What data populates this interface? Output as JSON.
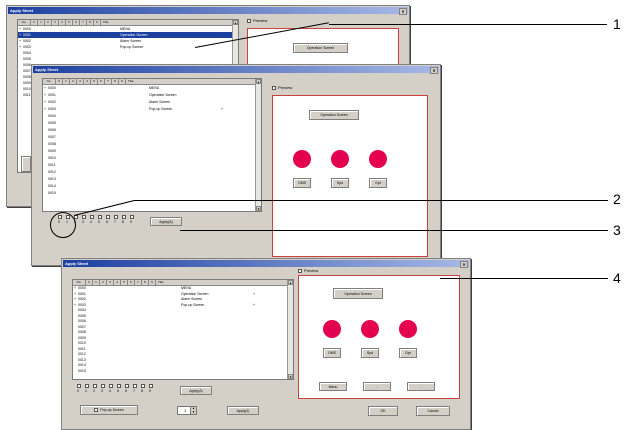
{
  "windows": [
    {
      "title": "Apply Sheet",
      "close_glyph": "✕",
      "grid_header": {
        "no": "No.",
        "cols": [
          "0",
          "1",
          "2",
          "3",
          "4",
          "5",
          "6",
          "7",
          "8",
          "9"
        ],
        "title": "Title"
      },
      "rows": [
        {
          "mark": "+",
          "no": "0000",
          "title": "MENU",
          "sub": "",
          "selected": false
        },
        {
          "mark": "+",
          "no": "0001",
          "title": "Operation Screen",
          "sub": "",
          "selected": true
        },
        {
          "mark": "+",
          "no": "0002",
          "title": "Alarm Screen",
          "sub": "",
          "selected": false
        },
        {
          "mark": "+",
          "no": "0003",
          "title": "Pop-up Screen",
          "sub": "+",
          "selected": false
        },
        {
          "mark": "",
          "no": "0004",
          "title": "",
          "sub": "",
          "selected": false
        },
        {
          "mark": "",
          "no": "0005",
          "title": "",
          "sub": "",
          "selected": false
        },
        {
          "mark": "",
          "no": "0006",
          "title": "",
          "sub": "",
          "selected": false
        },
        {
          "mark": "",
          "no": "0007",
          "title": "",
          "sub": "",
          "selected": false
        },
        {
          "mark": "",
          "no": "0008",
          "title": "",
          "sub": "",
          "selected": false
        },
        {
          "mark": "",
          "no": "0009",
          "title": "",
          "sub": "",
          "selected": false
        },
        {
          "mark": "",
          "no": "0010",
          "title": "",
          "sub": "",
          "selected": false
        },
        {
          "mark": "",
          "no": "0011",
          "title": "",
          "sub": "",
          "selected": false
        }
      ],
      "preview_label": "Preview",
      "operation_button": "Operation Screen"
    },
    {
      "title": "Apply Sheet",
      "close_glyph": "✕",
      "grid_header": {
        "no": "No.",
        "cols": [
          "0",
          "1",
          "2",
          "3",
          "4",
          "5",
          "6",
          "7",
          "8",
          "9"
        ],
        "title": "Title"
      },
      "rows": [
        {
          "mark": "+",
          "no": "0000",
          "title": "MENU",
          "sub": "",
          "selected": false
        },
        {
          "mark": "+",
          "no": "0001",
          "title": "Operation Screen",
          "sub": "",
          "selected": false
        },
        {
          "mark": "+",
          "no": "0002",
          "title": "Alarm Screen",
          "sub": "",
          "selected": false
        },
        {
          "mark": "+",
          "no": "0003",
          "title": "Pop-up Screen",
          "sub": "+",
          "selected": false
        },
        {
          "mark": "",
          "no": "0004",
          "title": "",
          "sub": "",
          "selected": false
        },
        {
          "mark": "",
          "no": "0005",
          "title": "",
          "sub": "",
          "selected": false
        },
        {
          "mark": "",
          "no": "0006",
          "title": "",
          "sub": "",
          "selected": false
        },
        {
          "mark": "",
          "no": "0007",
          "title": "",
          "sub": "",
          "selected": false
        },
        {
          "mark": "",
          "no": "0008",
          "title": "",
          "sub": "",
          "selected": false
        },
        {
          "mark": "",
          "no": "0009",
          "title": "",
          "sub": "",
          "selected": false
        },
        {
          "mark": "",
          "no": "0010",
          "title": "",
          "sub": "",
          "selected": false
        },
        {
          "mark": "",
          "no": "0011",
          "title": "",
          "sub": "",
          "selected": false
        },
        {
          "mark": "",
          "no": "0012",
          "title": "",
          "sub": "",
          "selected": false
        },
        {
          "mark": "",
          "no": "0013",
          "title": "",
          "sub": "",
          "selected": false
        },
        {
          "mark": "",
          "no": "0014",
          "title": "",
          "sub": "",
          "selected": false
        },
        {
          "mark": "",
          "no": "0015",
          "title": "",
          "sub": "",
          "selected": false
        }
      ],
      "preview_label": "Preview",
      "operation_button": "Operation Screen",
      "lamp_buttons": [
        "OMS",
        "Spd",
        "Opt"
      ],
      "sheet_checks": [
        "0",
        "1",
        "2",
        "3",
        "4",
        "5",
        "6",
        "7",
        "8",
        "9"
      ],
      "apply_all": "Apply(A)"
    },
    {
      "title": "Apply Sheet",
      "close_glyph": "✕",
      "grid_header": {
        "no": "No.",
        "cols": [
          "0",
          "1",
          "2",
          "3",
          "4",
          "5",
          "6",
          "7",
          "8",
          "9"
        ],
        "title": "Title"
      },
      "rows": [
        {
          "mark": "+",
          "no": "0000",
          "title": "MENU",
          "sub": "",
          "selected": false
        },
        {
          "mark": "+",
          "no": "0001",
          "title": "Operation Screen",
          "sub": "+",
          "selected": false
        },
        {
          "mark": "+",
          "no": "0002",
          "title": "Alarm Screen",
          "sub": "",
          "selected": false
        },
        {
          "mark": "+",
          "no": "0003",
          "title": "Pop-up Screen",
          "sub": "+",
          "selected": false
        },
        {
          "mark": "",
          "no": "0004",
          "title": "",
          "sub": "",
          "selected": false
        },
        {
          "mark": "",
          "no": "0005",
          "title": "",
          "sub": "",
          "selected": false
        },
        {
          "mark": "",
          "no": "0006",
          "title": "",
          "sub": "",
          "selected": false
        },
        {
          "mark": "",
          "no": "0007",
          "title": "",
          "sub": "",
          "selected": false
        },
        {
          "mark": "",
          "no": "0008",
          "title": "",
          "sub": "",
          "selected": false
        },
        {
          "mark": "",
          "no": "0009",
          "title": "",
          "sub": "",
          "selected": false
        },
        {
          "mark": "",
          "no": "0010",
          "title": "",
          "sub": "",
          "selected": false
        },
        {
          "mark": "",
          "no": "0011",
          "title": "",
          "sub": "",
          "selected": false
        },
        {
          "mark": "",
          "no": "0012",
          "title": "",
          "sub": "",
          "selected": false
        },
        {
          "mark": "",
          "no": "0013",
          "title": "",
          "sub": "",
          "selected": false
        },
        {
          "mark": "",
          "no": "0014",
          "title": "",
          "sub": "",
          "selected": false
        },
        {
          "mark": "",
          "no": "0015",
          "title": "",
          "sub": "",
          "selected": false
        }
      ],
      "preview_label": "Preview",
      "operation_button": "Operation Screen",
      "lamp_buttons": [
        "OMS",
        "Spd",
        "Opt"
      ],
      "nav_buttons": [
        "Menu",
        "-",
        "-"
      ],
      "sheet_checks": [
        "0",
        "1",
        "2",
        "3",
        "4",
        "5",
        "6",
        "7",
        "8",
        "9"
      ],
      "apply_all": "Apply(A)",
      "popup_label": "Pop-up Screen",
      "popup_value": "1",
      "apply_popup": "Apply(J)",
      "ok": "OK",
      "cancel": "Cancel"
    }
  ],
  "callouts": [
    "1",
    "2",
    "3",
    "4"
  ],
  "colors": {
    "titlebar": "#1c3fa0",
    "lamp": "#e3004f",
    "preview_border": "#c9423b",
    "dialog": "#d4d0c8"
  }
}
